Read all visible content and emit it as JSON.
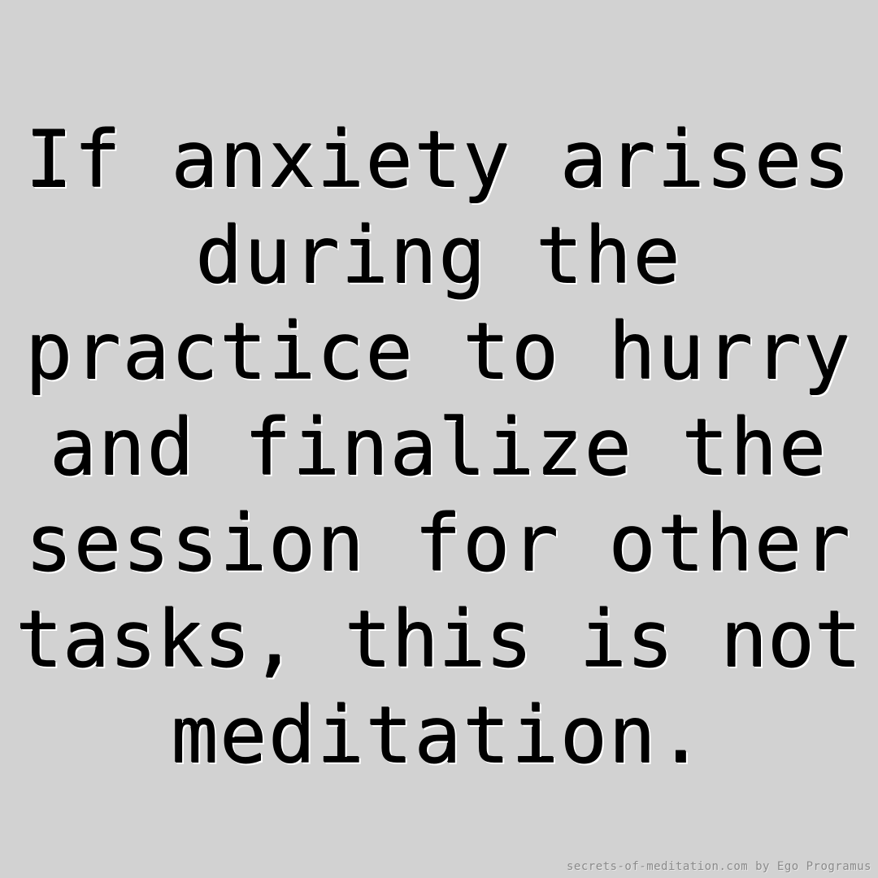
{
  "quote": {
    "lines": [
      "If anxiety arises",
      "during the",
      "practice to hurry",
      "and finalize the",
      "session for other",
      "tasks, this is not",
      "meditation."
    ]
  },
  "credit": "secrets-of-meditation.com by Ego Programus",
  "colors": {
    "background": "#d2d2d2",
    "text": "#000000",
    "text_outline": "#ffffff",
    "credit_text": "#8a8a8a"
  }
}
